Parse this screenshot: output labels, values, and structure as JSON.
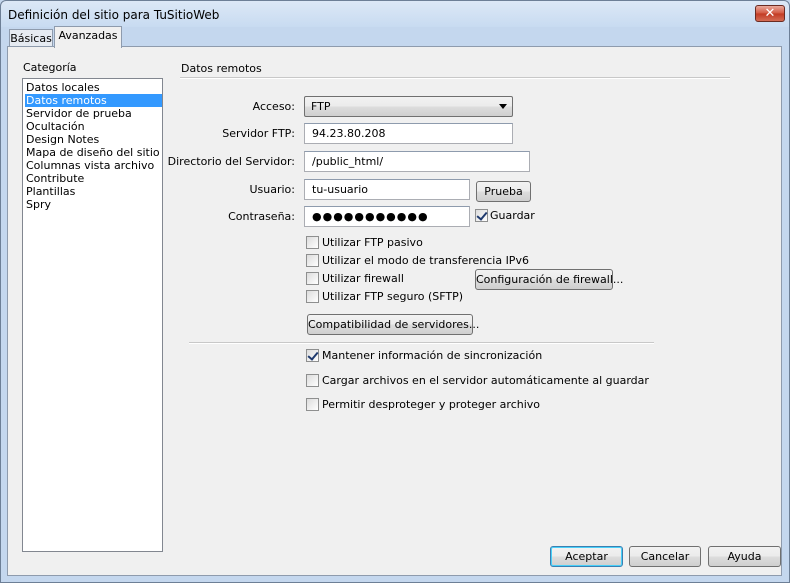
{
  "window": {
    "title": "Definición del sitio para TuSitioWeb",
    "close_glyph": "✕"
  },
  "tabs": [
    {
      "label": "Básicas",
      "active": false
    },
    {
      "label": "Avanzadas",
      "active": true
    }
  ],
  "sidebar": {
    "heading": "Categoría",
    "items": [
      {
        "label": "Datos locales",
        "selected": false
      },
      {
        "label": "Datos remotos",
        "selected": true
      },
      {
        "label": "Servidor de prueba",
        "selected": false
      },
      {
        "label": "Ocultación",
        "selected": false
      },
      {
        "label": "Design Notes",
        "selected": false
      },
      {
        "label": "Mapa de diseño del sitio",
        "selected": false
      },
      {
        "label": "Columnas vista archivo",
        "selected": false
      },
      {
        "label": "Contribute",
        "selected": false
      },
      {
        "label": "Plantillas",
        "selected": false
      },
      {
        "label": "Spry",
        "selected": false
      }
    ]
  },
  "section": {
    "title": "Datos remotos"
  },
  "form": {
    "access_label": "Acceso:",
    "access_value": "FTP",
    "ftp_server_label": "Servidor FTP:",
    "ftp_server_value": "94.23.80.208",
    "server_dir_label": "Directorio del Servidor:",
    "server_dir_value": "/public_html/",
    "user_label": "Usuario:",
    "user_value": "tu-usuario",
    "test_button": "Prueba",
    "password_label": "Contraseña:",
    "password_value": "●●●●●●●●●●●",
    "save_label": "Guardar",
    "save_checked": true
  },
  "options": [
    {
      "label": "Utilizar FTP pasivo",
      "checked": false
    },
    {
      "label": "Utilizar el modo de transferencia IPv6",
      "checked": false
    },
    {
      "label": "Utilizar firewall",
      "checked": false
    },
    {
      "label": "Utilizar FTP seguro (SFTP)",
      "checked": false
    }
  ],
  "firewall_button": "Configuración de firewall...",
  "compat_button": "Compatibilidad de servidores...",
  "sync_options": [
    {
      "label": "Mantener información de sincronización",
      "checked": true
    },
    {
      "label": "Cargar archivos en el servidor automáticamente al guardar",
      "checked": false
    },
    {
      "label": "Permitir desproteger y proteger archivo",
      "checked": false
    }
  ],
  "footer": {
    "accept": "Aceptar",
    "cancel": "Cancelar",
    "help": "Ayuda"
  },
  "colors": {
    "selection": "#3399ff",
    "titlebar": "#c8dbf1",
    "dialog_bg": "#f0f0f0"
  }
}
